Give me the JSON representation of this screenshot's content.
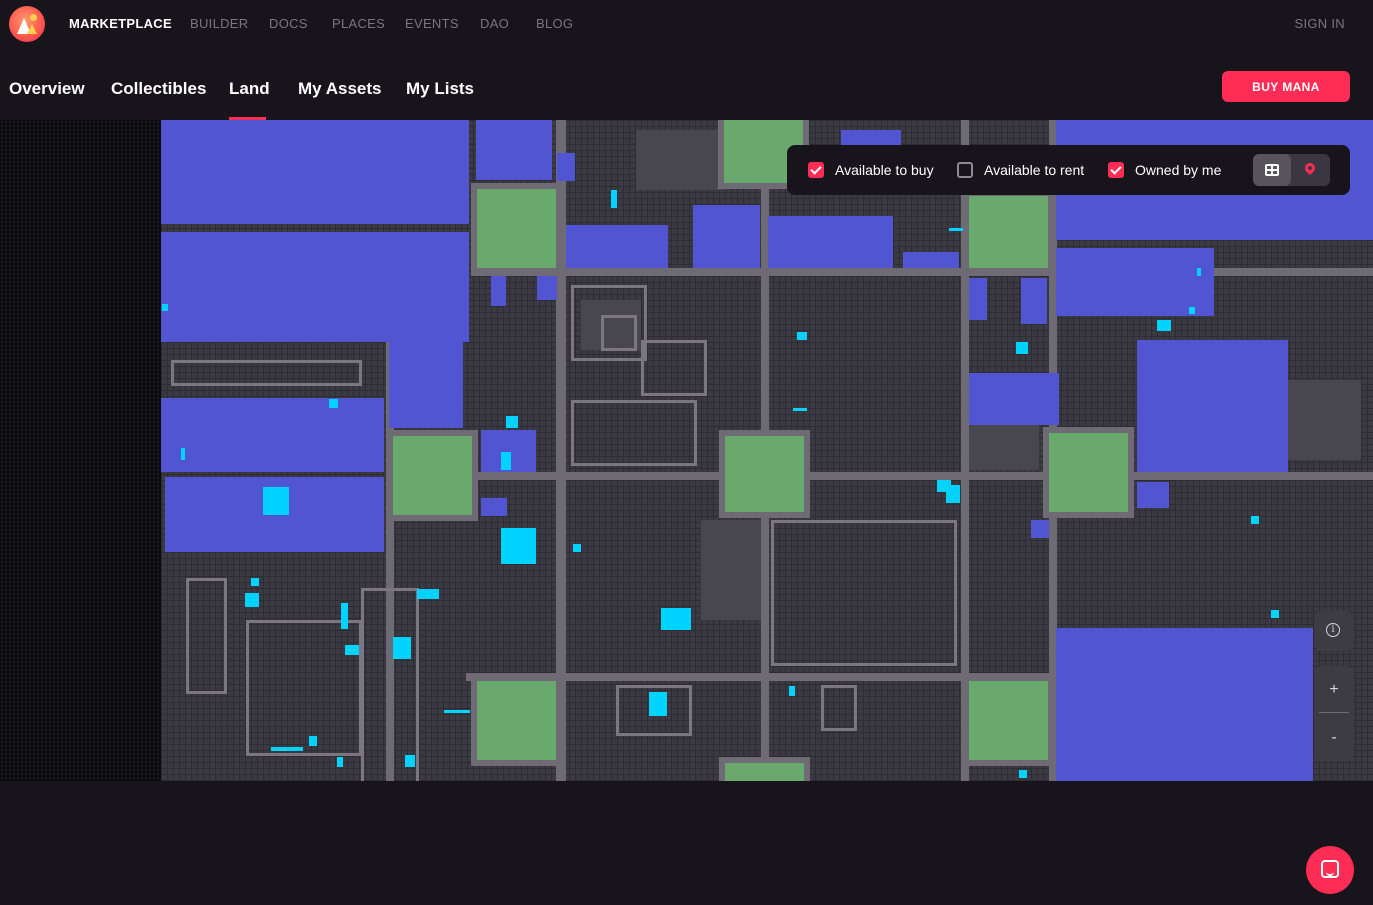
{
  "brand": {
    "logo_icon": "decentraland-logo-icon"
  },
  "topnav": {
    "items": [
      "MARKETPLACE",
      "BUILDER",
      "DOCS",
      "PLACES",
      "EVENTS",
      "DAO",
      "BLOG"
    ],
    "active": "MARKETPLACE",
    "signin": "SIGN IN"
  },
  "subnav": {
    "tabs": [
      "Overview",
      "Collectibles",
      "Land",
      "My Assets",
      "My Lists"
    ],
    "active_tab": "Land",
    "buy_button": "BUY MANA"
  },
  "filters": {
    "available_to_buy": {
      "label": "Available to buy",
      "checked": true
    },
    "available_to_rent": {
      "label": "Available to rent",
      "checked": false
    },
    "owned_by_me": {
      "label": "Owned by me",
      "checked": true
    },
    "view_toggle": {
      "selected": "grid",
      "options": [
        "grid-icon",
        "pin-icon"
      ]
    }
  },
  "map_controls": {
    "info": "i",
    "zoom_in": "+",
    "zoom_out": "-"
  },
  "colors": {
    "accent": "#ff2d55",
    "estate": "#5155d1",
    "plaza": "#6aa96e",
    "road": "#6e6b74",
    "on_sale": "#00d3ff",
    "background": "#17141b"
  }
}
